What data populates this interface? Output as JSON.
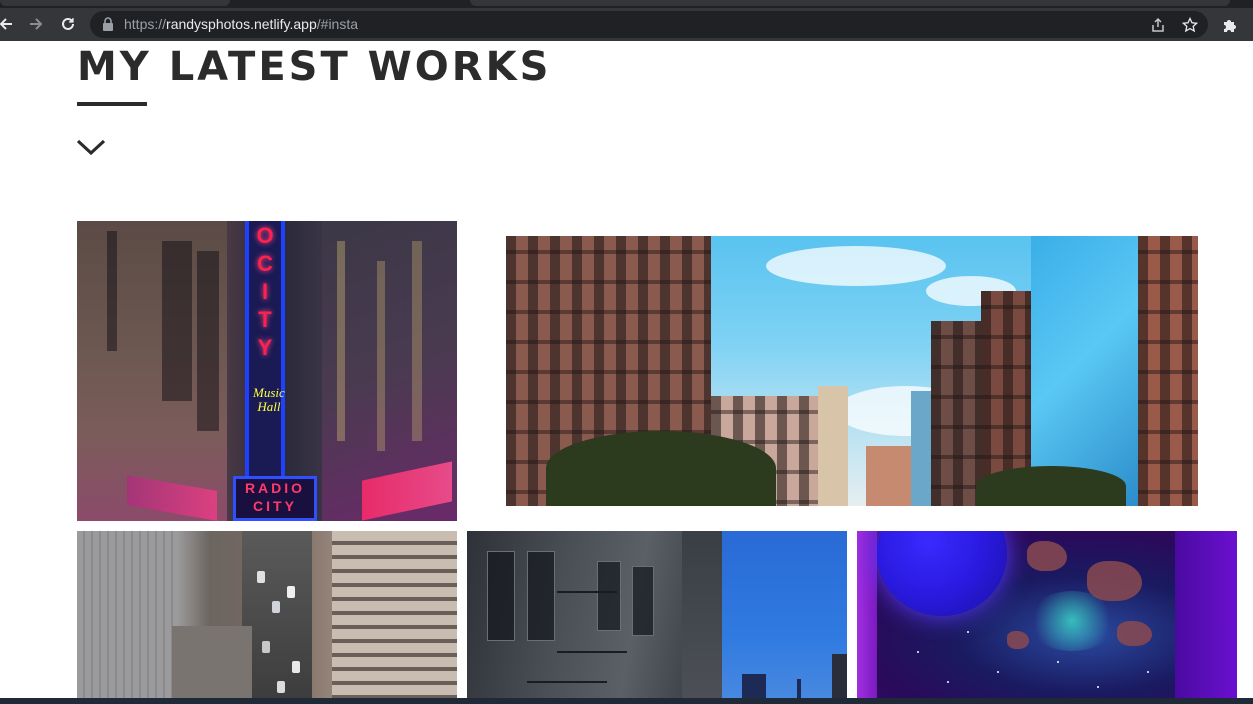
{
  "browser": {
    "url_scheme": "https://",
    "url_host": "randysphotos.netlify.app",
    "url_path": "/#insta",
    "icons": [
      "back-icon",
      "forward-icon",
      "reload-icon",
      "lock-icon",
      "share-icon",
      "bookmark-star-icon",
      "extensions-icon"
    ]
  },
  "page": {
    "heading": "MY LATEST WORKS"
  },
  "photos": {
    "p1": {
      "sign_letters": [
        "O",
        "C",
        "I",
        "T",
        "Y"
      ],
      "music_line1": "Music",
      "music_line2": "Hall",
      "marquee_line1": "RADIO",
      "marquee_line2": "CITY"
    }
  },
  "colors": {
    "heading": "#2b2b2b",
    "chrome_toolbar": "#35363a",
    "omnibox": "#202124"
  }
}
